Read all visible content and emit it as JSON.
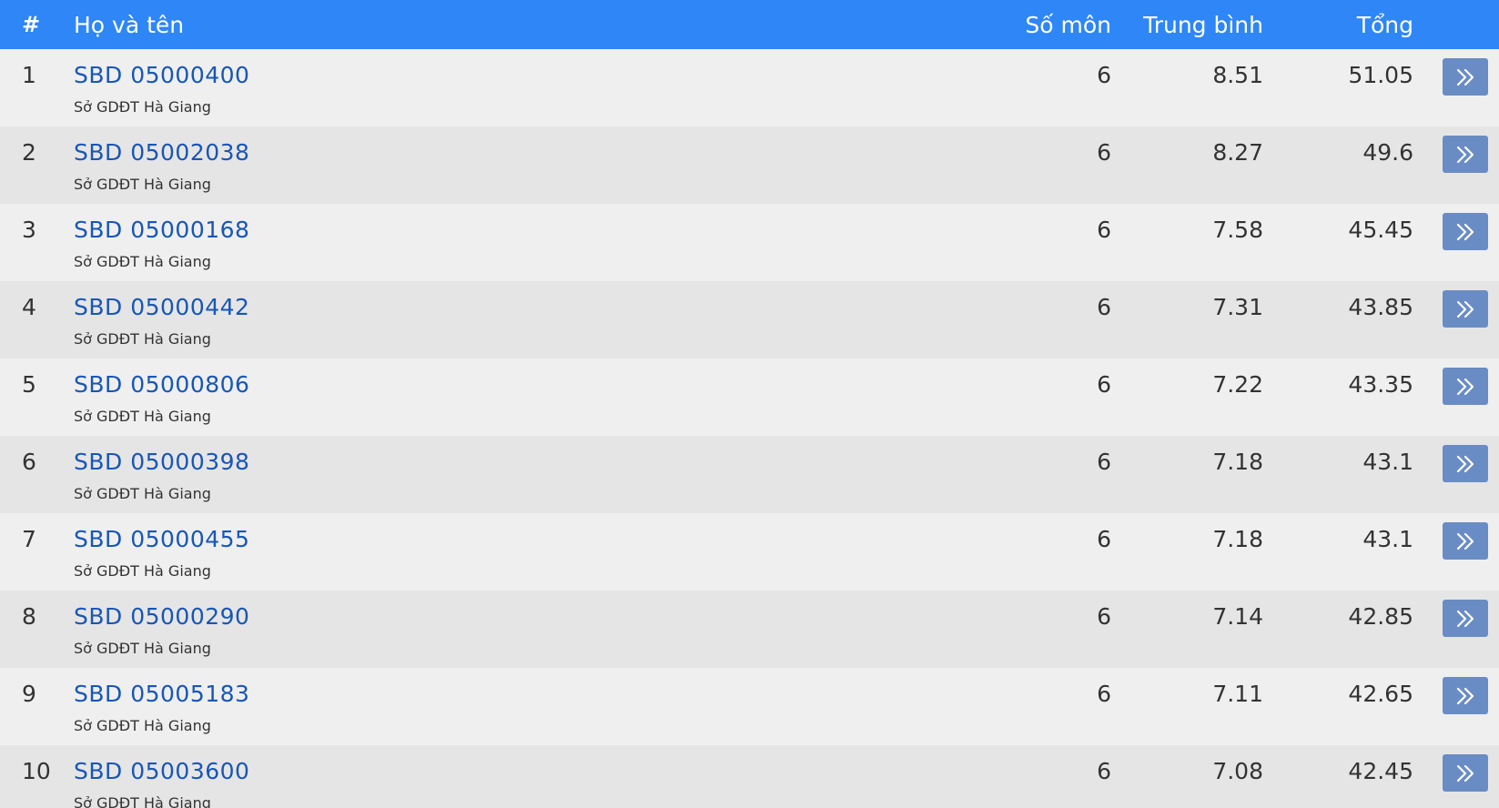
{
  "header": {
    "num": "#",
    "name": "Họ và tên",
    "so_mon": "Số môn",
    "trung_binh": "Trung bình",
    "tong": "Tổng"
  },
  "rows": [
    {
      "rank": "1",
      "sbd": "SBD 05000400",
      "org": "Sở GDĐT Hà Giang",
      "so_mon": "6",
      "trung_binh": "8.51",
      "tong": "51.05"
    },
    {
      "rank": "2",
      "sbd": "SBD 05002038",
      "org": "Sở GDĐT Hà Giang",
      "so_mon": "6",
      "trung_binh": "8.27",
      "tong": "49.6"
    },
    {
      "rank": "3",
      "sbd": "SBD 05000168",
      "org": "Sở GDĐT Hà Giang",
      "so_mon": "6",
      "trung_binh": "7.58",
      "tong": "45.45"
    },
    {
      "rank": "4",
      "sbd": "SBD 05000442",
      "org": "Sở GDĐT Hà Giang",
      "so_mon": "6",
      "trung_binh": "7.31",
      "tong": "43.85"
    },
    {
      "rank": "5",
      "sbd": "SBD 05000806",
      "org": "Sở GDĐT Hà Giang",
      "so_mon": "6",
      "trung_binh": "7.22",
      "tong": "43.35"
    },
    {
      "rank": "6",
      "sbd": "SBD 05000398",
      "org": "Sở GDĐT Hà Giang",
      "so_mon": "6",
      "trung_binh": "7.18",
      "tong": "43.1"
    },
    {
      "rank": "7",
      "sbd": "SBD 05000455",
      "org": "Sở GDĐT Hà Giang",
      "so_mon": "6",
      "trung_binh": "7.18",
      "tong": "43.1"
    },
    {
      "rank": "8",
      "sbd": "SBD 05000290",
      "org": "Sở GDĐT Hà Giang",
      "so_mon": "6",
      "trung_binh": "7.14",
      "tong": "42.85"
    },
    {
      "rank": "9",
      "sbd": "SBD 05005183",
      "org": "Sở GDĐT Hà Giang",
      "so_mon": "6",
      "trung_binh": "7.11",
      "tong": "42.65"
    },
    {
      "rank": "10",
      "sbd": "SBD 05003600",
      "org": "Sở GDĐT Hà Giang",
      "so_mon": "6",
      "trung_binh": "7.08",
      "tong": "42.45"
    }
  ],
  "icons": {
    "row_action": "double-chevron-right-icon"
  },
  "colors": {
    "header_bg": "#2e86f7",
    "link": "#1857b5",
    "button": "#6a8cc4",
    "row_odd": "#efefef",
    "row_even": "#e6e5e6"
  }
}
